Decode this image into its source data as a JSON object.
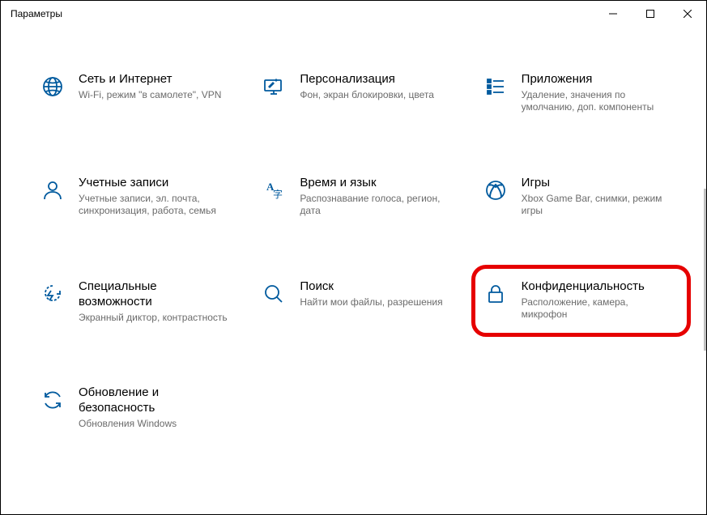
{
  "window": {
    "title": "Параметры"
  },
  "icon_color": "#005A9E",
  "tiles": [
    {
      "id": "network",
      "title": "Сеть и Интернет",
      "desc": "Wi-Fi, режим \"в самолете\", VPN"
    },
    {
      "id": "personalization",
      "title": "Персонализация",
      "desc": "Фон, экран блокировки, цвета"
    },
    {
      "id": "apps",
      "title": "Приложения",
      "desc": "Удаление, значения по умолчанию, доп. компоненты"
    },
    {
      "id": "accounts",
      "title": "Учетные записи",
      "desc": "Учетные записи, эл. почта, синхронизация, работа, семья"
    },
    {
      "id": "time",
      "title": "Время и язык",
      "desc": "Распознавание голоса, регион, дата"
    },
    {
      "id": "gaming",
      "title": "Игры",
      "desc": "Xbox Game Bar, снимки, режим игры"
    },
    {
      "id": "ease",
      "title": "Специальные возможности",
      "desc": "Экранный диктор, контрастность"
    },
    {
      "id": "search",
      "title": "Поиск",
      "desc": "Найти мои файлы, разрешения"
    },
    {
      "id": "privacy",
      "title": "Конфиденциальность",
      "desc": "Расположение, камера, микрофон"
    },
    {
      "id": "update",
      "title": "Обновление и безопасность",
      "desc": "Обновления Windows"
    }
  ]
}
